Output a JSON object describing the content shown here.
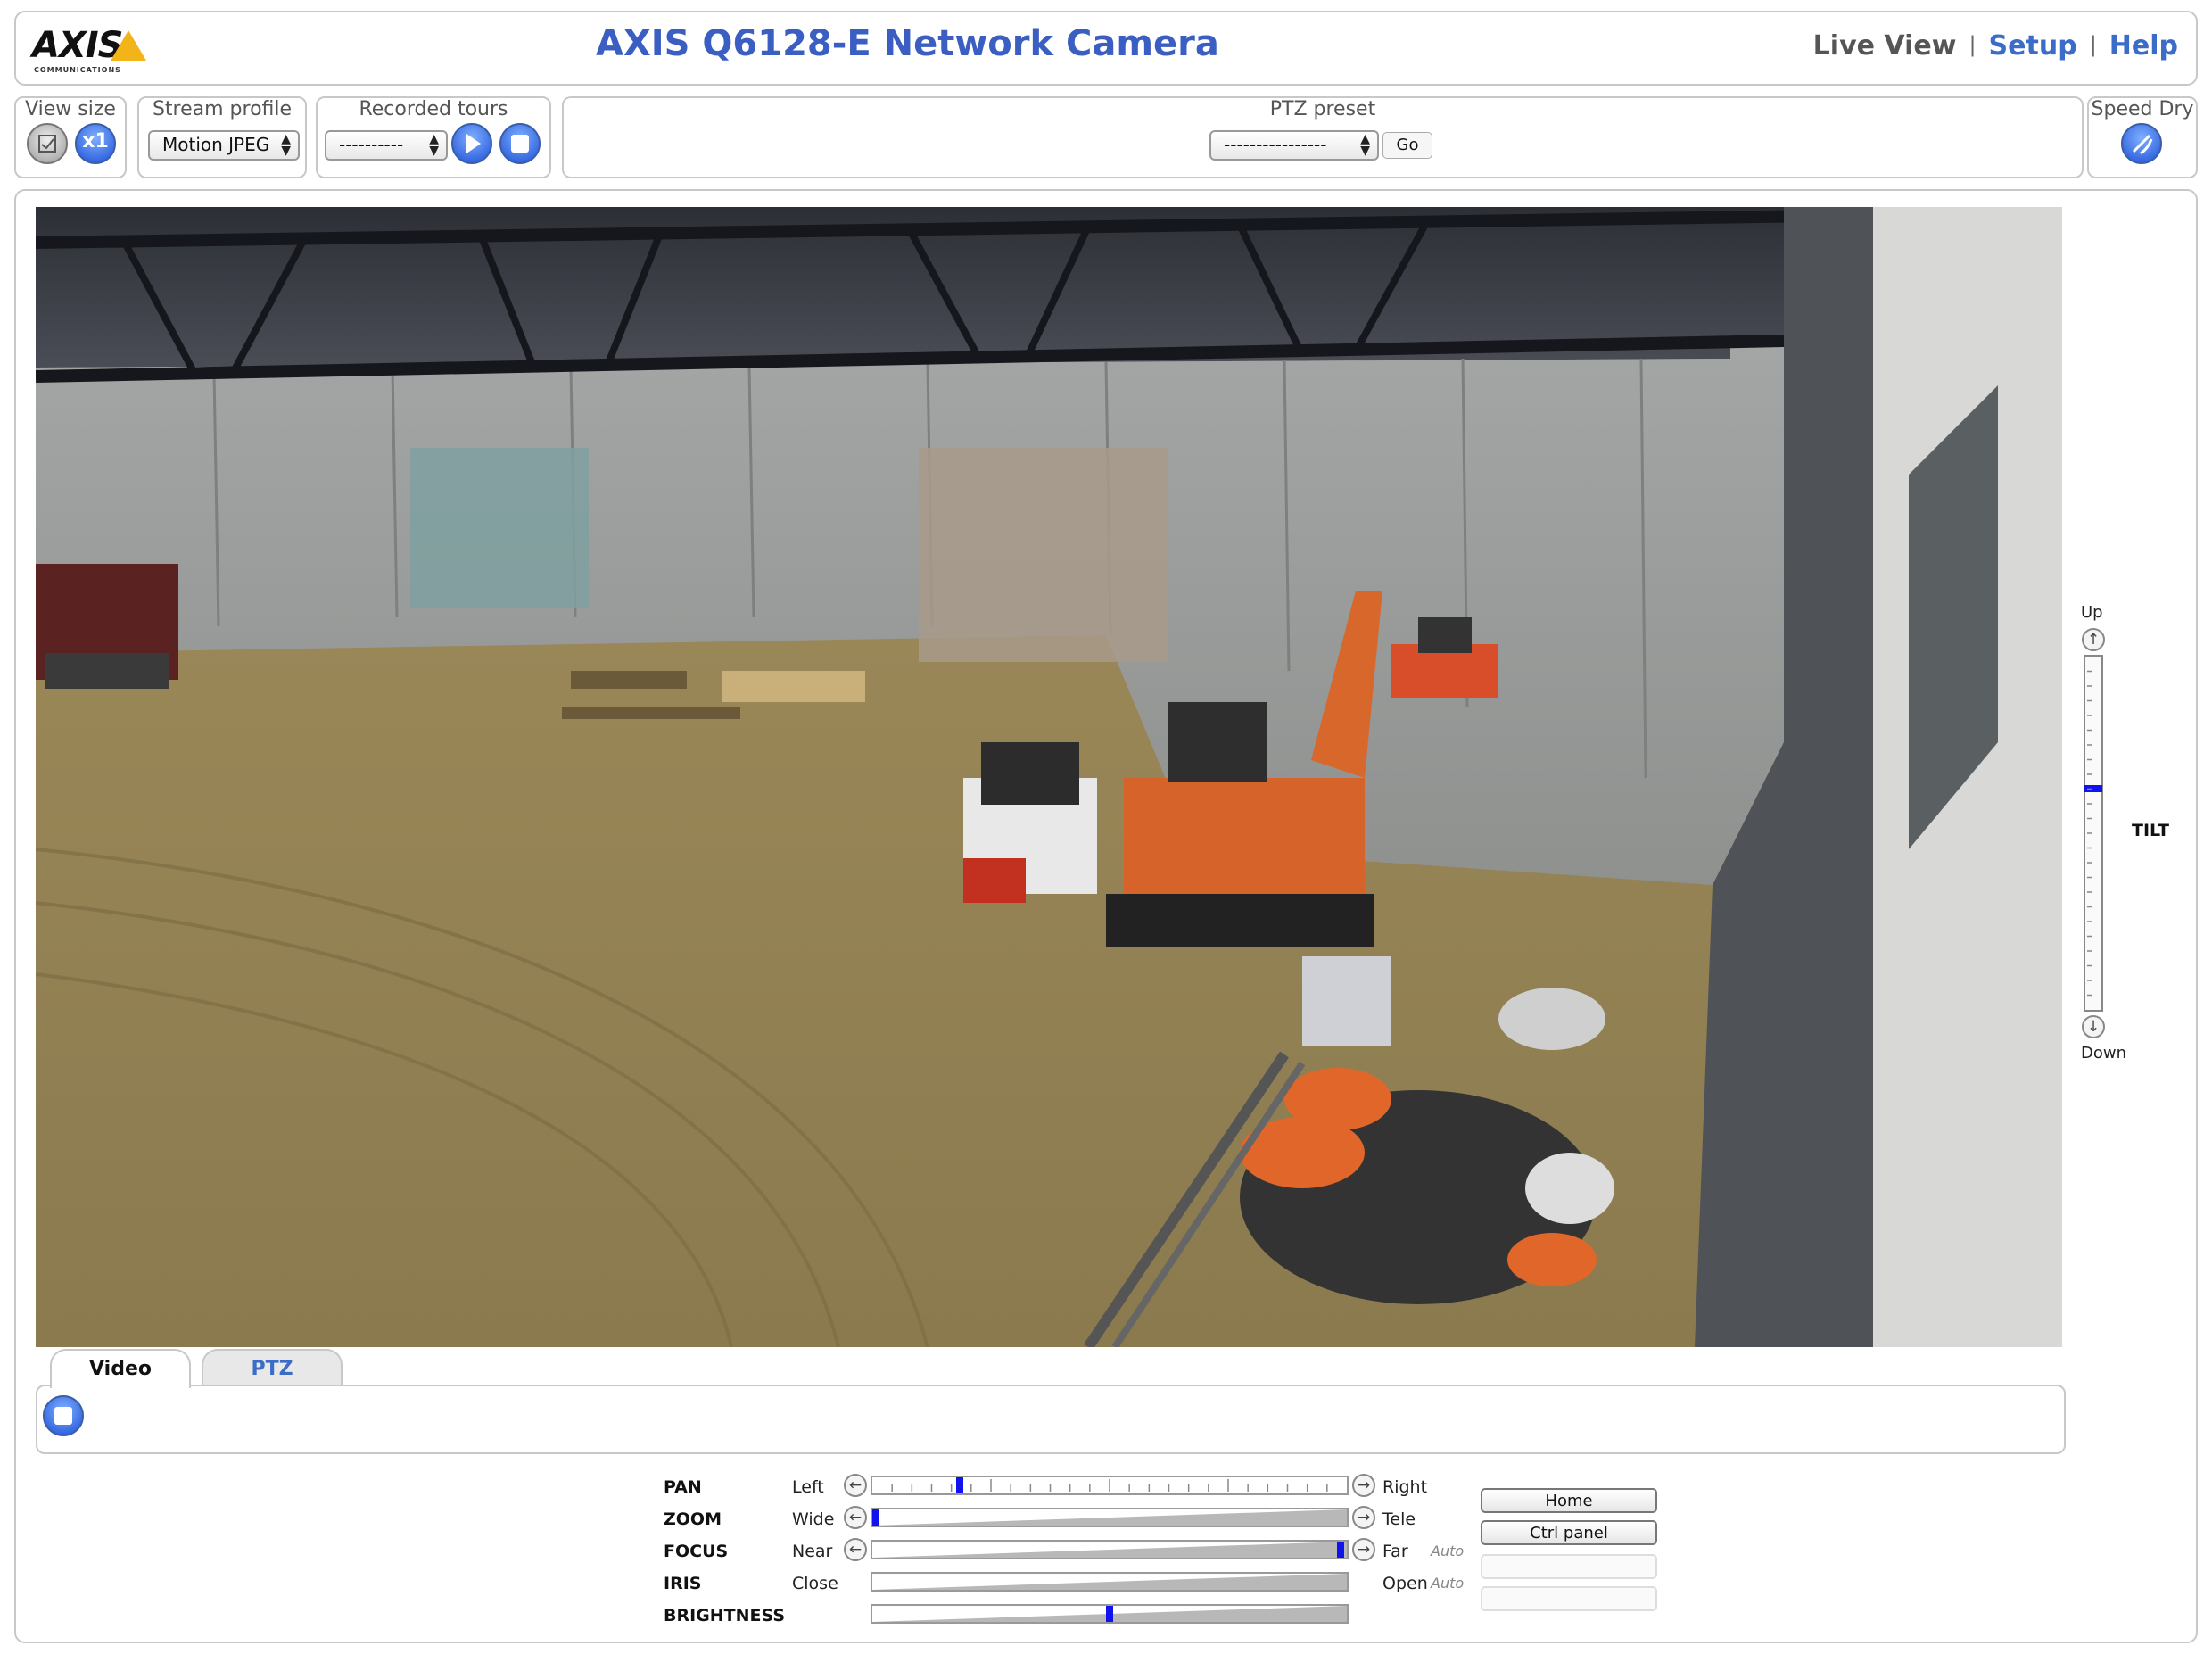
{
  "header": {
    "logo_text": "AXIS",
    "logo_sub": "COMMUNICATIONS",
    "title": "AXIS Q6128-E Network Camera",
    "nav": {
      "live_view": "Live View",
      "setup": "Setup",
      "help": "Help",
      "separator": "|"
    }
  },
  "toolbar": {
    "view_size": {
      "title": "View size",
      "buttons": [
        "fit-to-window",
        "x1"
      ],
      "x1_label": "x1"
    },
    "stream_profile": {
      "title": "Stream profile",
      "selected": "Motion JPEG"
    },
    "recorded_tours": {
      "title": "Recorded tours",
      "selected": "----------"
    },
    "ptz_preset": {
      "title": "PTZ preset",
      "selected": "----------------",
      "go_label": "Go"
    },
    "speed_dry": {
      "title": "Speed Dry"
    }
  },
  "tilt": {
    "up_label": "Up",
    "down_label": "Down",
    "title": "TILT",
    "level": 0.37
  },
  "tabs": [
    {
      "label": "Video",
      "active": true
    },
    {
      "label": "PTZ",
      "active": false
    }
  ],
  "controls": {
    "pan": {
      "label": "PAN",
      "min_label": "Left",
      "max_label": "Right",
      "value": 0.18
    },
    "zoom": {
      "label": "ZOOM",
      "min_label": "Wide",
      "max_label": "Tele",
      "value": 0.0
    },
    "focus": {
      "label": "FOCUS",
      "min_label": "Near",
      "max_label": "Far",
      "auto_label": "Auto",
      "value": 0.995
    },
    "iris": {
      "label": "IRIS",
      "min_label": "Close",
      "max_label": "Open",
      "auto_label": "Auto"
    },
    "brightness": {
      "label": "BRIGHTNESS",
      "value": 0.5
    },
    "buttons": {
      "home": "Home",
      "ctrl_panel": "Ctrl panel"
    }
  },
  "colors": {
    "title_blue": "#3b5ec2",
    "link_blue": "#3b6cc8",
    "slider_knob": "#1212ee",
    "panel_border": "#c8c8c8",
    "axis_yellow": "#f2b418"
  }
}
